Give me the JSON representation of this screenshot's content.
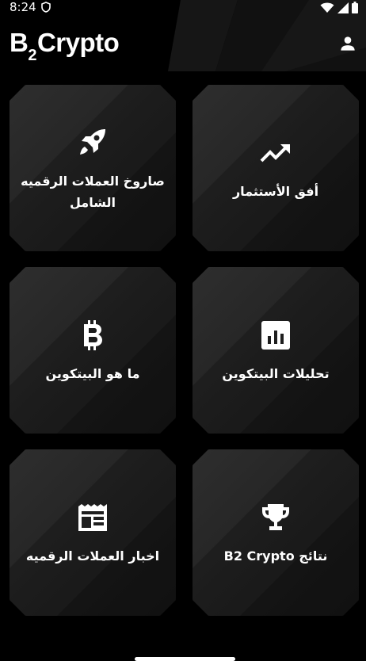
{
  "status_bar": {
    "time": "8:24",
    "icons": [
      "shield-icon",
      "wifi-icon",
      "signal-icon",
      "battery-icon"
    ]
  },
  "header": {
    "brand_prefix": "B",
    "brand_sub": "2",
    "brand_suffix": "Crypto",
    "profile_icon": "person-icon"
  },
  "cards": [
    {
      "icon": "rocket-icon",
      "label": "صاروخ العملات الرقميه الشامل"
    },
    {
      "icon": "trending-up-icon",
      "label": "أفق الأستثمار"
    },
    {
      "icon": "bitcoin-icon",
      "label": "ما هو البيتكوين"
    },
    {
      "icon": "bar-chart-icon",
      "label": "تحليلات البيتكوين"
    },
    {
      "icon": "newspaper-icon",
      "label": "اخبار العملات الرقميه"
    },
    {
      "icon": "trophy-icon",
      "label": "نتائج B2 Crypto"
    }
  ],
  "colors": {
    "background": "#000000",
    "card": "#1e1e1e",
    "text": "#ffffff"
  }
}
